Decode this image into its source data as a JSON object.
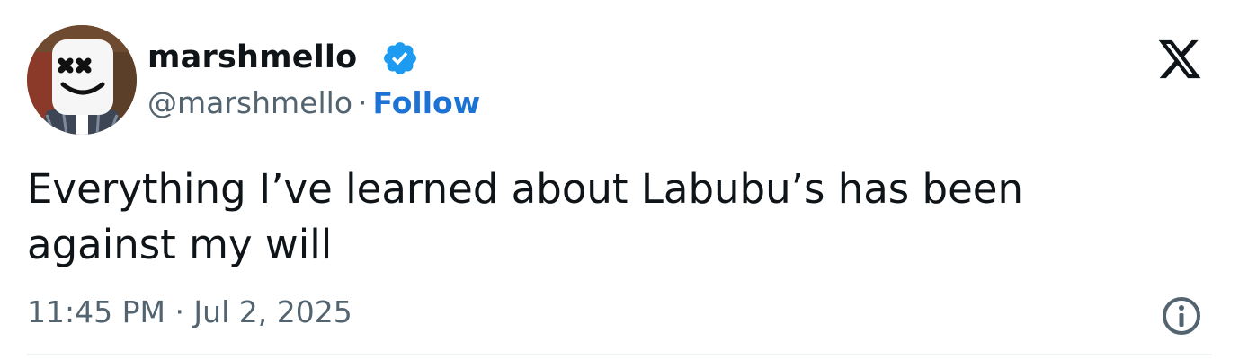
{
  "author": {
    "display_name": "marshmello",
    "handle": "@marshmello",
    "separator": "·",
    "follow_label": "Follow",
    "verified": true,
    "avatar_icon": "marshmello-helmet-avatar"
  },
  "tweet": {
    "text": "Everything I’ve learned about Labubu’s has been\nagainst my will",
    "timestamp": "11:45 PM · Jul 2, 2025"
  },
  "icons": {
    "brand": "x-logo-icon",
    "verified": "verified-badge-icon",
    "info": "info-icon"
  },
  "colors": {
    "text": "#0f1419",
    "secondary_text": "#536471",
    "follow_blue": "#1d73d4",
    "verified_blue": "#1d9bf0"
  }
}
